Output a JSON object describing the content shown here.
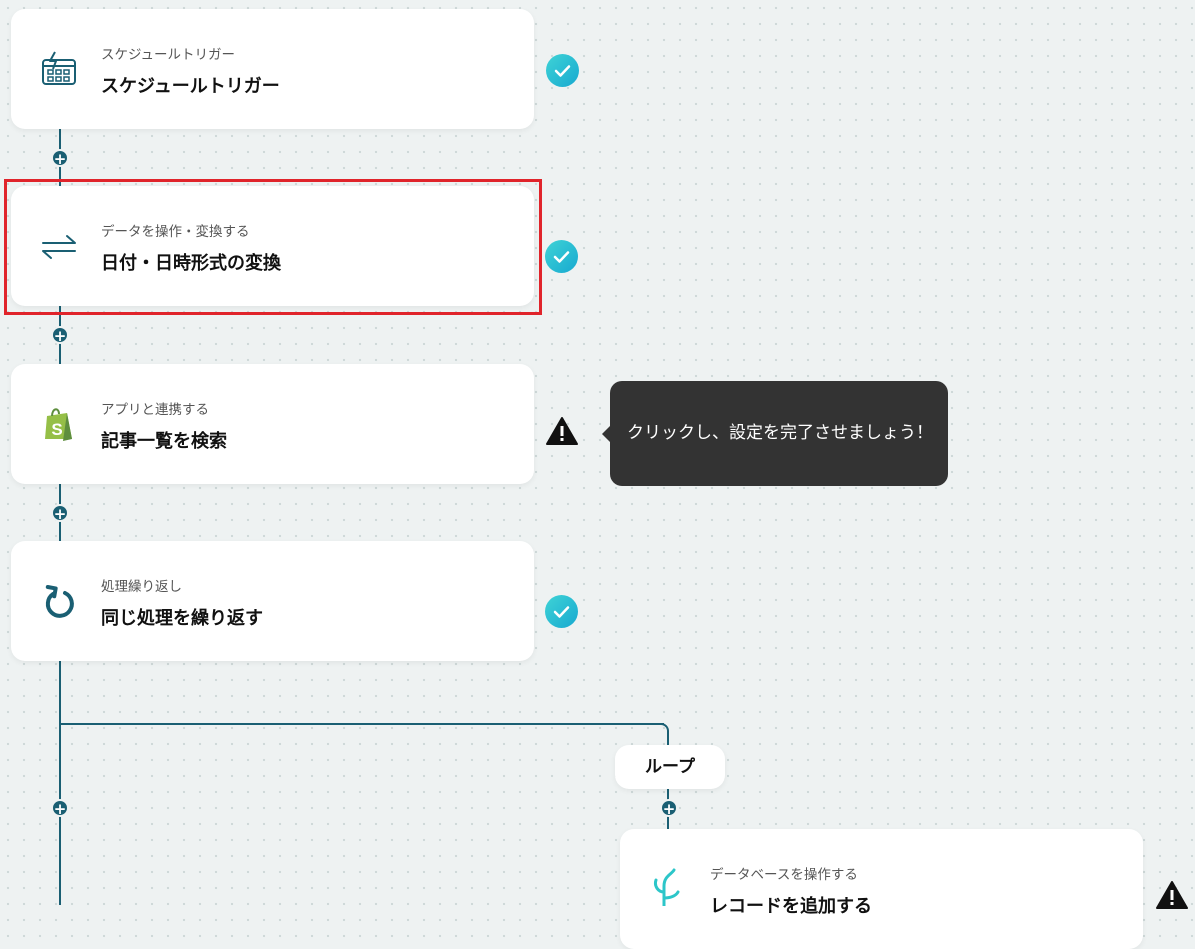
{
  "steps": [
    {
      "subtitle": "スケジュールトリガー",
      "title": "スケジュールトリガー",
      "icon": "calendar-lightning-icon",
      "status": "done"
    },
    {
      "subtitle": "データを操作・変換する",
      "title": "日付・日時形式の変換",
      "icon": "swap-arrows-icon",
      "status": "done"
    },
    {
      "subtitle": "アプリと連携する",
      "title": "記事一覧を検索",
      "icon": "shopify-bag-icon",
      "status": "warning"
    },
    {
      "subtitle": "処理繰り返し",
      "title": "同じ処理を繰り返す",
      "icon": "loop-icon",
      "status": "done"
    }
  ],
  "branch_step": {
    "subtitle": "データベースを操作する",
    "title": "レコードを追加する",
    "icon": "database-plant-icon",
    "status": "warning"
  },
  "tooltip": {
    "text": "クリックし、設定を完了させましょう！"
  },
  "loop": {
    "label": "ループ"
  },
  "add_symbol": "+",
  "colors": {
    "connector": "#1a5f73",
    "check": "#1fb8d3",
    "highlight": "#e0242b",
    "tooltip_bg": "#333333",
    "shopify": "#95bf47"
  }
}
